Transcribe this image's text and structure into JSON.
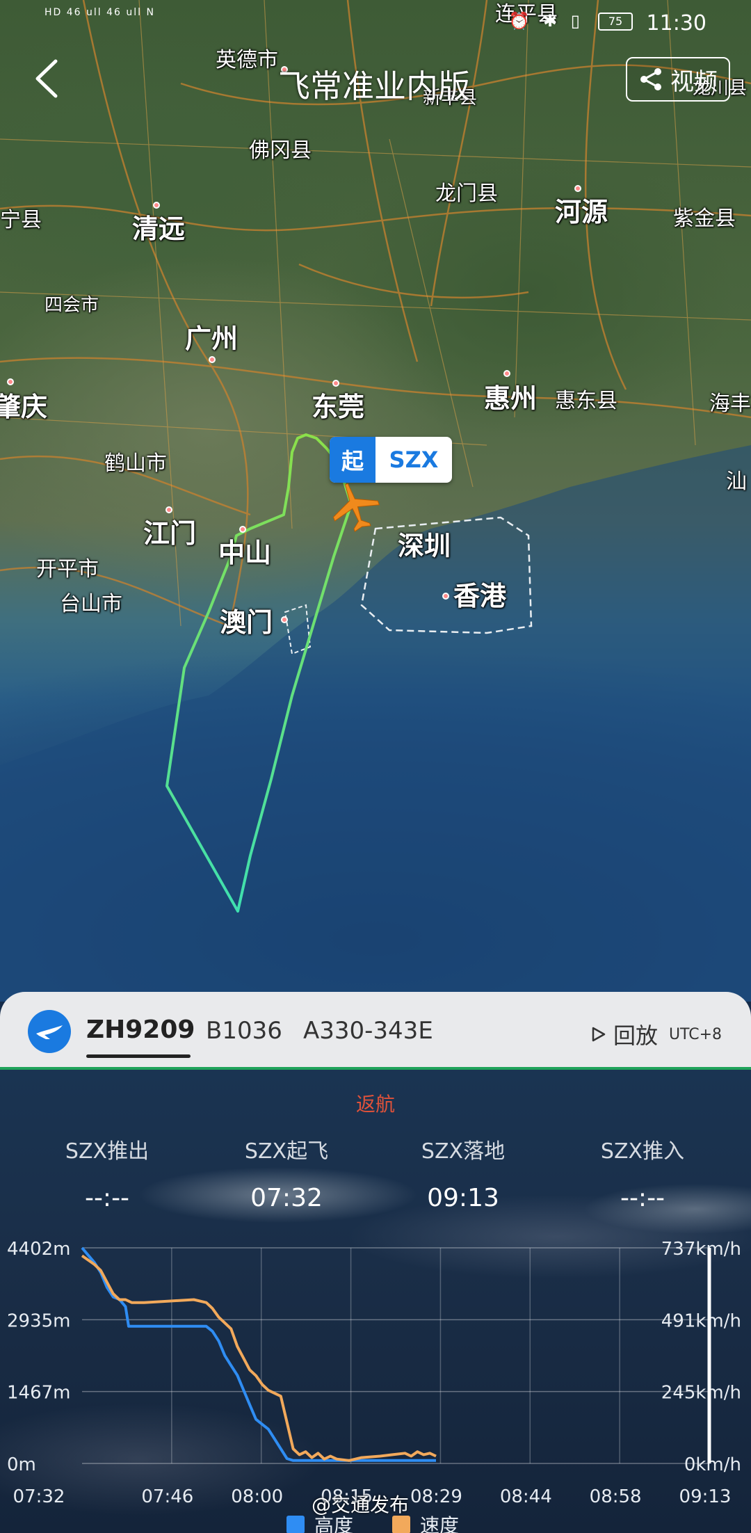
{
  "status_bar": {
    "left_icons": "HD 46 ull 46 ull N",
    "status_icons": "⏰ ✱ ▯",
    "battery": "75",
    "time": "11:30"
  },
  "header": {
    "title": "飞常准业内版",
    "video_label": "视频"
  },
  "map": {
    "places": [
      {
        "name": "连平县"
      },
      {
        "name": "英德市"
      },
      {
        "name": "新丰县"
      },
      {
        "name": "龙川县"
      },
      {
        "name": "佛冈县"
      },
      {
        "name": "龙门县"
      },
      {
        "name": "河源"
      },
      {
        "name": "紫金县"
      },
      {
        "name": "宁县"
      },
      {
        "name": "清远"
      },
      {
        "name": "四会市"
      },
      {
        "name": "广州"
      },
      {
        "name": "肇庆"
      },
      {
        "name": "东莞"
      },
      {
        "name": "惠州"
      },
      {
        "name": "惠东县"
      },
      {
        "name": "海丰"
      },
      {
        "name": "鹤山市"
      },
      {
        "name": "汕"
      },
      {
        "name": "江门"
      },
      {
        "name": "中山"
      },
      {
        "name": "深圳"
      },
      {
        "name": "开平市"
      },
      {
        "name": "台山市"
      },
      {
        "name": "香港"
      },
      {
        "name": "澳门"
      }
    ],
    "departure_tag": {
      "key": "起",
      "code": "SZX"
    }
  },
  "flight": {
    "number": "ZH9209",
    "registration": "B1036",
    "aircraft": "A330-343E",
    "replay_label": "回放",
    "timezone": "UTC+8"
  },
  "panel": {
    "status": "返航",
    "times": [
      {
        "label": "SZX推出",
        "value": "--:--"
      },
      {
        "label": "SZX起飞",
        "value": "07:32"
      },
      {
        "label": "SZX落地",
        "value": "09:13"
      },
      {
        "label": "SZX推入",
        "value": "--:--"
      }
    ]
  },
  "chart_data": {
    "type": "line",
    "x_ticks": [
      "07:32",
      "07:46",
      "08:00",
      "08:15",
      "08:29",
      "08:44",
      "08:58",
      "09:13"
    ],
    "y_left_ticks": [
      "4402m",
      "2935m",
      "1467m",
      "0m"
    ],
    "y_right_ticks": [
      "737km/h",
      "491km/h",
      "245km/h",
      "0km/h"
    ],
    "ylim_left": [
      0,
      4402
    ],
    "ylim_right": [
      0,
      737
    ],
    "x_minutes_range": [
      0,
      101
    ],
    "legend_position": "center",
    "series": [
      {
        "name": "高度",
        "color": "#2f8df3",
        "axis": "left",
        "points": [
          [
            0,
            4402
          ],
          [
            1,
            4250
          ],
          [
            2,
            4100
          ],
          [
            3,
            3900
          ],
          [
            4,
            3600
          ],
          [
            5,
            3400
          ],
          [
            6,
            3350
          ],
          [
            7,
            3200
          ],
          [
            7.5,
            2800
          ],
          [
            8,
            2800
          ],
          [
            15,
            2800
          ],
          [
            20,
            2800
          ],
          [
            21,
            2700
          ],
          [
            22,
            2500
          ],
          [
            23,
            2200
          ],
          [
            24,
            2000
          ],
          [
            25,
            1800
          ],
          [
            26,
            1500
          ],
          [
            27,
            1200
          ],
          [
            28,
            900
          ],
          [
            29,
            800
          ],
          [
            30,
            700
          ],
          [
            31,
            500
          ],
          [
            32,
            300
          ],
          [
            33,
            100
          ],
          [
            34,
            60
          ],
          [
            36,
            60
          ],
          [
            40,
            60
          ],
          [
            45,
            60
          ],
          [
            50,
            60
          ],
          [
            55,
            60
          ],
          [
            57,
            60
          ]
        ]
      },
      {
        "name": "速度",
        "color": "#f2a95b",
        "axis": "right",
        "points": [
          [
            0,
            710
          ],
          [
            2,
            680
          ],
          [
            3,
            660
          ],
          [
            4,
            620
          ],
          [
            5,
            580
          ],
          [
            6,
            560
          ],
          [
            7,
            560
          ],
          [
            8,
            550
          ],
          [
            10,
            550
          ],
          [
            14,
            555
          ],
          [
            18,
            560
          ],
          [
            20,
            550
          ],
          [
            21,
            530
          ],
          [
            22,
            500
          ],
          [
            23,
            480
          ],
          [
            24,
            460
          ],
          [
            25,
            400
          ],
          [
            26,
            360
          ],
          [
            27,
            320
          ],
          [
            28,
            300
          ],
          [
            29,
            270
          ],
          [
            30,
            250
          ],
          [
            31,
            240
          ],
          [
            32,
            230
          ],
          [
            33,
            140
          ],
          [
            34,
            50
          ],
          [
            35,
            30
          ],
          [
            36,
            40
          ],
          [
            37,
            20
          ],
          [
            38,
            35
          ],
          [
            39,
            15
          ],
          [
            40,
            25
          ],
          [
            41,
            15
          ],
          [
            43,
            10
          ],
          [
            45,
            20
          ],
          [
            48,
            25
          ],
          [
            50,
            30
          ],
          [
            52,
            35
          ],
          [
            53,
            25
          ],
          [
            54,
            40
          ],
          [
            55,
            30
          ],
          [
            56,
            35
          ],
          [
            57,
            25
          ]
        ]
      }
    ]
  },
  "watermark": "@交通发布"
}
